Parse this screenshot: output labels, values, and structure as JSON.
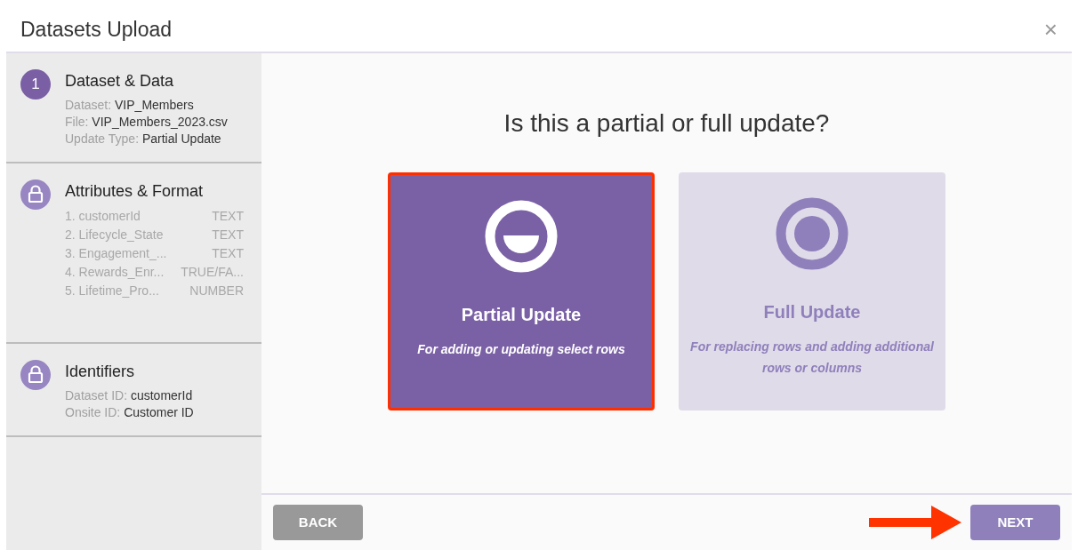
{
  "window": {
    "title": "Datasets Upload",
    "close": "×"
  },
  "steps": [
    {
      "kind": "number",
      "badge": "1",
      "title": "Dataset & Data",
      "details": [
        {
          "label": "Dataset:",
          "value": "VIP_Members"
        },
        {
          "label": "File:",
          "value": "VIP_Members_2023.csv"
        },
        {
          "label": "Update Type:",
          "value": "Partial Update"
        }
      ]
    },
    {
      "kind": "locked",
      "title": "Attributes & Format",
      "attributes": [
        {
          "name": "1. customerId",
          "type": "TEXT"
        },
        {
          "name": "2. Lifecycle_State",
          "type": "TEXT"
        },
        {
          "name": "3. Engagement_...",
          "type": "TEXT"
        },
        {
          "name": "4. Rewards_Enr...",
          "type": "TRUE/FA..."
        },
        {
          "name": "5. Lifetime_Pro...",
          "type": "NUMBER"
        }
      ]
    },
    {
      "kind": "locked",
      "title": "Identifiers",
      "details": [
        {
          "label": "Dataset ID:",
          "value": "customerId"
        },
        {
          "label": "Onsite ID:",
          "value": "Customer ID"
        }
      ]
    }
  ],
  "question": "Is this a partial or full update?",
  "options": [
    {
      "kind": "partial",
      "title": "Partial Update",
      "description": "For adding or updating select rows",
      "selected": true
    },
    {
      "kind": "full",
      "title": "Full Update",
      "description": "For replacing rows and adding additional rows or columns",
      "selected": false
    }
  ],
  "buttons": {
    "back": "BACK",
    "next": "NEXT"
  }
}
